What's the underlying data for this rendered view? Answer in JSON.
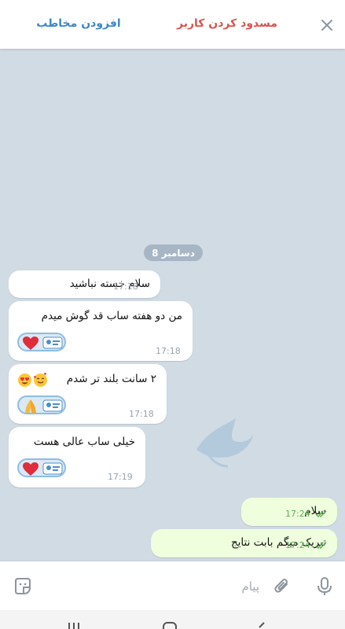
{
  "header": {
    "block_user_label": "مسدود کردن کاربر",
    "add_contact_label": "افزودن مخاطب",
    "close_icon": "close-icon"
  },
  "chat": {
    "date_label": "8 دسامبر",
    "messages": [
      {
        "direction": "incoming",
        "text": "سلام خسته نباشید",
        "time": "17:18"
      },
      {
        "direction": "incoming",
        "text": "من دو هفته ساب قد گوش میدم",
        "time": "17:18",
        "sticker": "heart"
      },
      {
        "direction": "incoming",
        "text": "۲ سانت بلند تر شدم",
        "emoji": "😍🥰",
        "time": "17:18",
        "sticker": "praying-hands"
      },
      {
        "direction": "incoming",
        "text": "خیلی ساب عالی هست",
        "time": "17:19",
        "sticker": "heart"
      },
      {
        "direction": "outgoing",
        "text": "سلام",
        "time": "17:24",
        "status": "read"
      },
      {
        "direction": "outgoing",
        "text": "تبریک میگم بابت نتایج",
        "time": "17:24",
        "status": "read"
      }
    ]
  },
  "input": {
    "placeholder": "پیام"
  },
  "colors": {
    "block_red": "#d9544e",
    "add_blue": "#3d87c7",
    "chat_background": "#d0dbe4",
    "outgoing_bubble": "#effedd",
    "read_tick_green": "#5fae57"
  }
}
